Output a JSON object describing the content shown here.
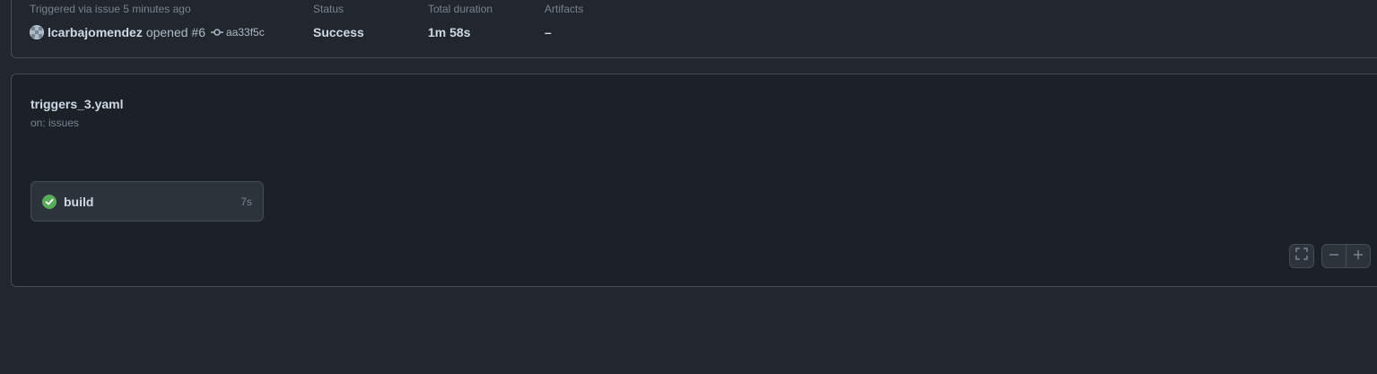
{
  "summary": {
    "trigger_label": "Triggered via issue 5 minutes ago",
    "actor": "lcarbajomendez",
    "action": "opened #6",
    "commit_sha": "aa33f5c",
    "status_label": "Status",
    "status_value": "Success",
    "duration_label": "Total duration",
    "duration_value": "1m 58s",
    "artifacts_label": "Artifacts",
    "artifacts_value": "–"
  },
  "workflow": {
    "file_name": "triggers_3.yaml",
    "trigger": "on: issues"
  },
  "jobs": [
    {
      "name": "build",
      "duration": "7s",
      "status": "success",
      "status_icon": "check-circle-fill-icon",
      "status_color": "#57ab5a"
    }
  ],
  "graph_controls": {
    "fullscreen_icon": "fullscreen-icon",
    "zoom_out_icon": "minus-icon",
    "zoom_in_icon": "plus-icon"
  },
  "colors": {
    "background": "#22272e",
    "graph_background": "#1c2128",
    "border": "#444c56",
    "success": "#57ab5a"
  }
}
